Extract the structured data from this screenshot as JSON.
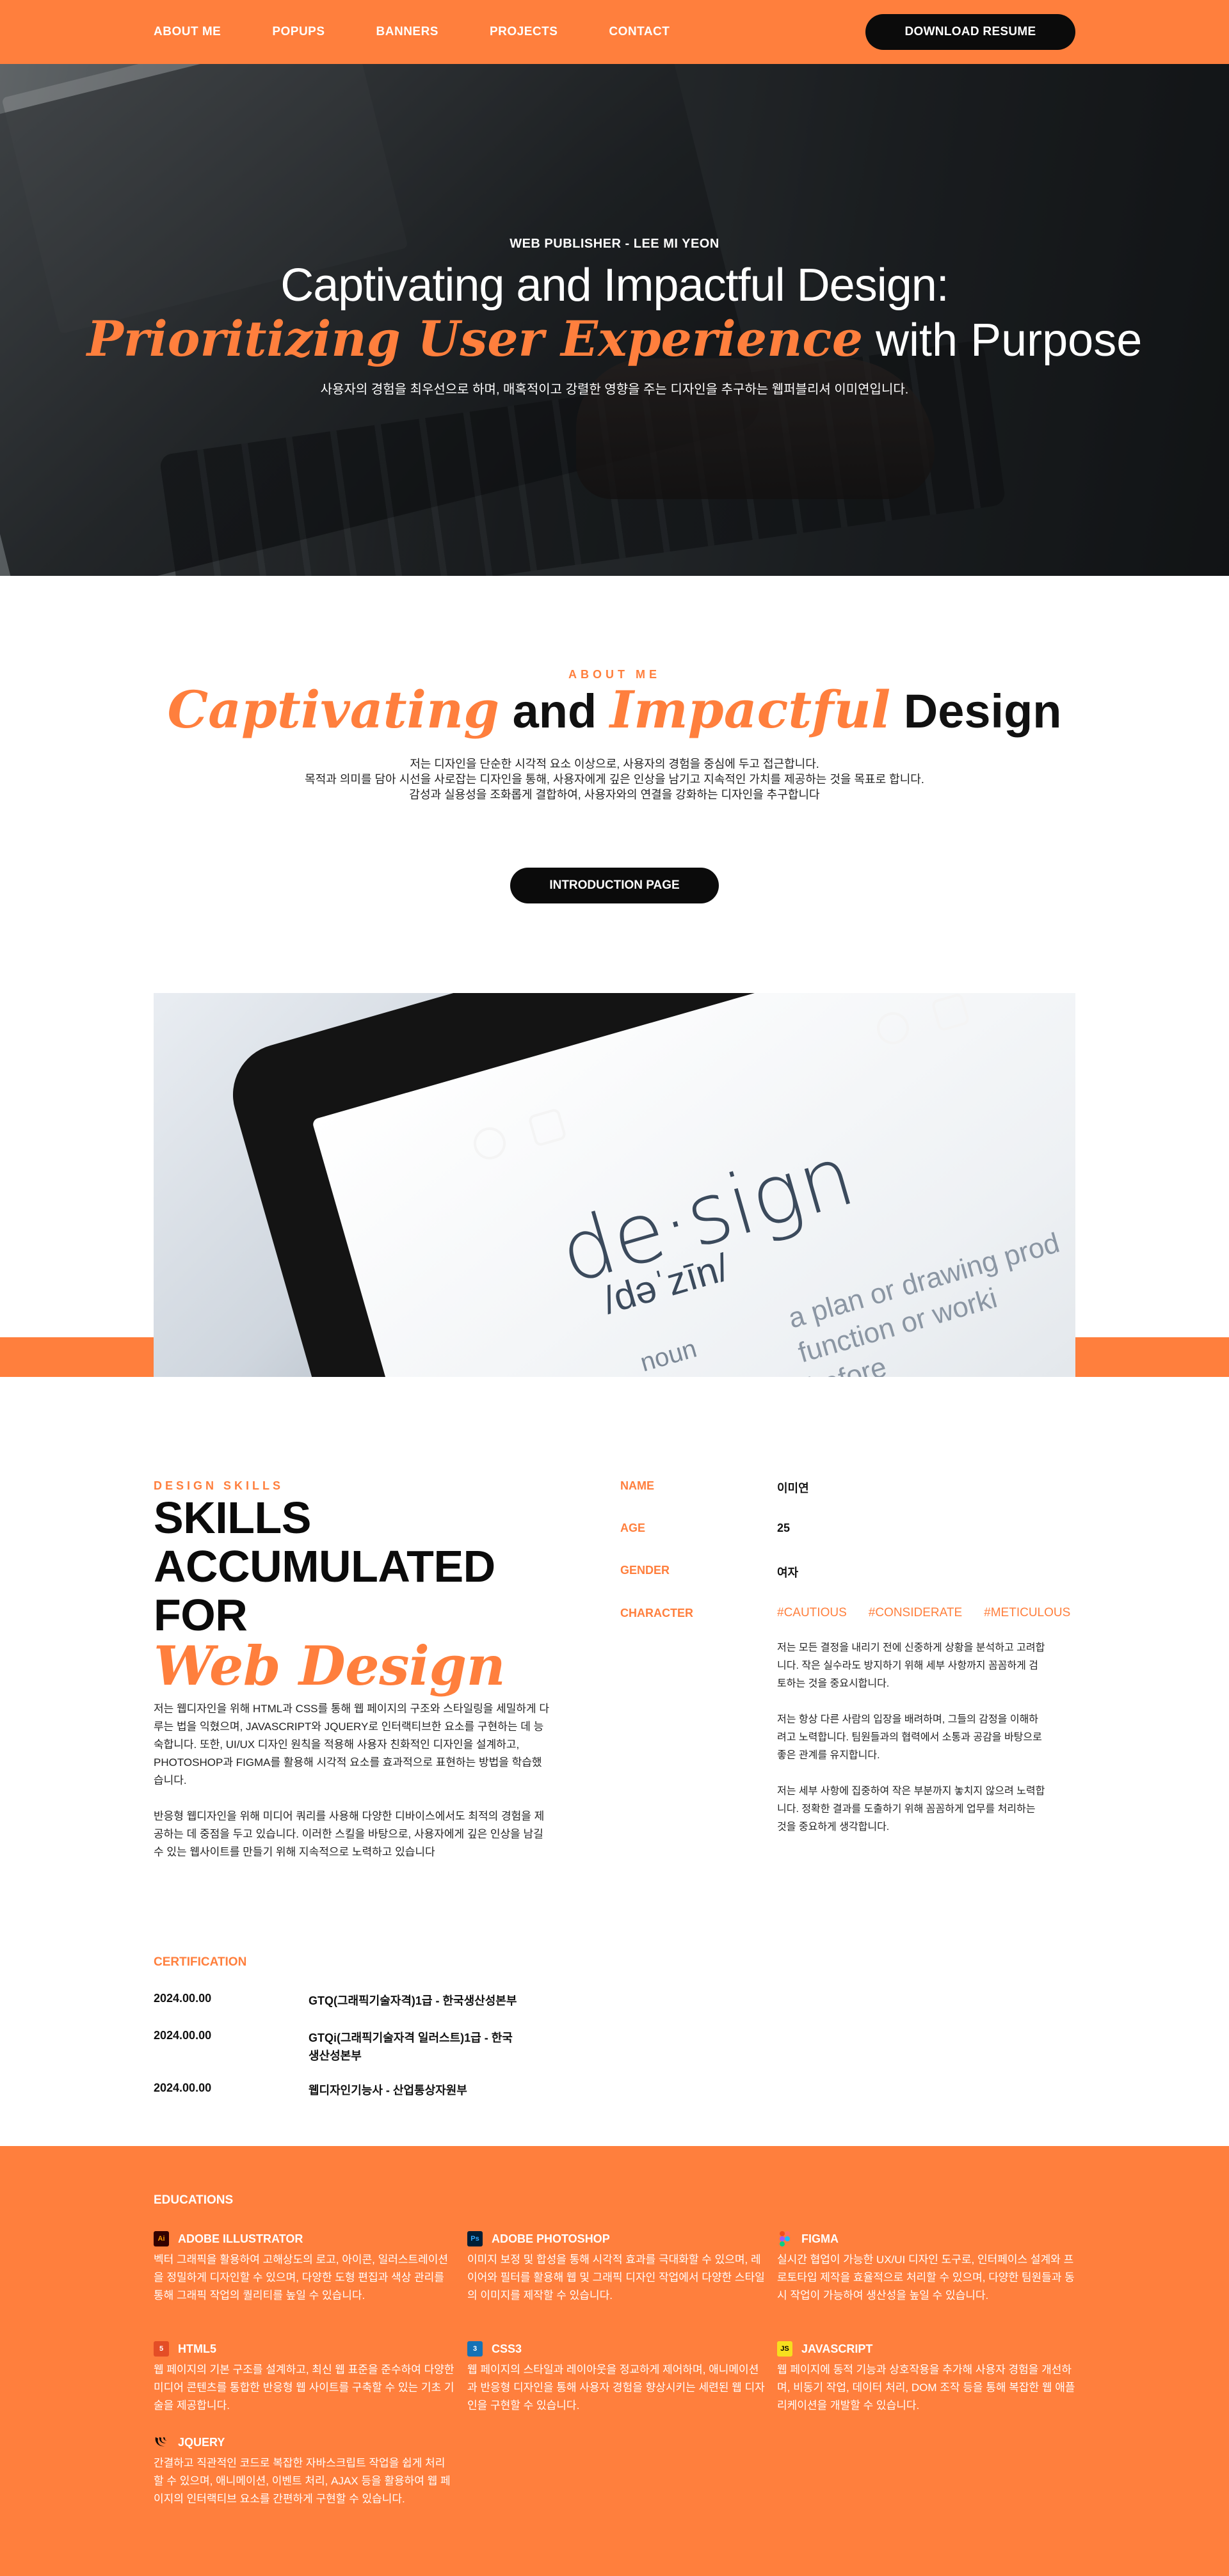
{
  "nav": {
    "links": [
      "ABOUT ME",
      "POPUPS",
      "BANNERS",
      "PROJECTS",
      "CONTACT"
    ],
    "download_label": "DOWNLOAD RESUME"
  },
  "hero": {
    "kicker": "WEB PUBLISHER - LEE MI YEON",
    "line1": "Captivating and Impactful Design:",
    "line2_accent": "Prioritizing User Experience",
    "line2_rest": " with Purpose",
    "sub": "사용자의 경험을 최우선으로 하며, 매혹적이고 강렬한 영향을 주는 디자인을 추구하는 웹퍼블리셔 이미연입니다."
  },
  "about": {
    "kicker": "ABOUT ME",
    "title_accent1": "Captivating",
    "title_and": " and ",
    "title_accent2": "Impactful",
    "title_design": " Design",
    "desc": [
      "저는 디자인을 단순한 시각적 요소 이상으로, 사용자의 경험을 중심에 두고 접근합니다.",
      "목적과 의미를 담아 시선을 사로잡는 디자인을 통해, 사용자에게 깊은 인상을 남기고 지속적인 가치를 제공하는 것을 목표로 합니다.",
      "감성과 실용성을 조화롭게 결합하여, 사용자와의 연결을 강화하는 디자인을 추구합니다"
    ],
    "button_label": "INTRODUCTION PAGE"
  },
  "design_image": {
    "word": "de·sign",
    "phonetic": "/dəˈzīn/",
    "pos": "noun",
    "definition": [
      "a plan or drawing prod",
      "function or worki",
      "before"
    ]
  },
  "skills": {
    "kicker": "DESIGN SKILLS",
    "title_lines": [
      "SKILLS",
      "ACCUMULATED",
      "FOR"
    ],
    "title_accent": "Web Design",
    "desc": [
      "저는 웹디자인을 위해 HTML과 CSS를 통해 웹 페이지의 구조와 스타일링을 세밀하게 다루는 법을 익혔으며, JAVASCRIPT와 JQUERY로 인터랙티브한 요소를 구현하는 데 능숙합니다. 또한, UI/UX 디자인 원칙을 적용해 사용자 친화적인 디자인을 설계하고, PHOTOSHOP과 FIGMA를 활용해 시각적 요소를 효과적으로 표현하는 방법을 학습했습니다.",
      "반응형 웹디자인을 위해 미디어 쿼리를 사용해 다양한 디바이스에서도 최적의 경험을 제공하는 데 중점을 두고 있습니다. 이러한 스킬을 바탕으로, 사용자에게 깊은 인상을 남길 수 있는 웹사이트를 만들기 위해 지속적으로 노력하고 있습니다"
    ]
  },
  "profile": {
    "name_label": "NAME",
    "name_value": "이미연",
    "age_label": "AGE",
    "age_value": "25",
    "gender_label": "GENDER",
    "gender_value": "여자",
    "character_label": "CHARACTER",
    "tags": [
      "#CAUTIOUS",
      "#CONSIDERATE",
      "#METICULOUS"
    ],
    "character_desc": [
      "저는 모든 결정을 내리기 전에 신중하게 상황을 분석하고 고려합니다. 작은 실수라도 방지하기 위해 세부 사항까지 꼼꼼하게 검토하는 것을 중요시합니다.",
      "저는 항상 다른 사람의 입장을 배려하며, 그들의 감정을 이해하려고 노력합니다. 팀원들과의 협력에서 소통과 공감을 바탕으로 좋은 관계를 유지합니다.",
      "저는 세부 사항에 집중하여 작은 부분까지 놓치지 않으려 노력합니다. 정확한 결과를 도출하기 위해 꼼꼼하게 업무를 처리하는 것을 중요하게 생각합니다."
    ]
  },
  "certification": {
    "title": "CERTIFICATION",
    "items": [
      {
        "date": "2024.00.00",
        "name": "GTQ(그래픽기술자격)1급 - 한국생산성본부"
      },
      {
        "date": "2024.00.00",
        "name": "GTQi(그래픽기술자격 일러스트)1급 - 한국생산성본부"
      },
      {
        "date": "2024.00.00",
        "name": "웹디자인기능사 - 산업통상자원부"
      }
    ]
  },
  "educations": {
    "title": "EDUCATIONS",
    "items": [
      {
        "name": "ADOBE ILLUSTRATOR",
        "icon": "illustrator-icon",
        "icon_text": "Ai",
        "color": "#ff9a00",
        "bg": "#330000",
        "desc": "벡터 그래픽을 활용하여 고해상도의 로고, 아이콘, 일러스트레이션을 정밀하게 디자인할 수 있으며, 다양한 도형 편집과 색상 관리를 통해 그래픽 작업의 퀄리티를 높일 수 있습니다."
      },
      {
        "name": "ADOBE PHOTOSHOP",
        "icon": "photoshop-icon",
        "icon_text": "Ps",
        "color": "#31a8ff",
        "bg": "#001e36",
        "desc": "이미지 보정 및 합성을 통해 시각적 효과를 극대화할 수 있으며, 레이어와 필터를 활용해 웹 및 그래픽 디자인 작업에서 다양한 스타일의 이미지를 제작할 수 있습니다."
      },
      {
        "name": "FIGMA",
        "icon": "figma-icon",
        "icon_text": "",
        "desc": "실시간 협업이 가능한 UX/UI 디자인 도구로, 인터페이스 설계와 프로토타입 제작을 효율적으로 처리할 수 있으며, 다양한 팀원들과 동시 작업이 가능하여 생산성을 높일 수 있습니다."
      },
      {
        "name": "HTML5",
        "icon": "html5-icon",
        "icon_text": "5",
        "color": "#ffffff",
        "bg": "#e44d26",
        "desc": "웹 페이지의 기본 구조를 설계하고, 최신 웹 표준을 준수하여 다양한 미디어 콘텐츠를 통합한 반응형 웹 사이트를 구축할 수 있는 기초 기술을 제공합니다."
      },
      {
        "name": "CSS3",
        "icon": "css3-icon",
        "icon_text": "3",
        "color": "#ffffff",
        "bg": "#1572b6",
        "desc": "웹 페이지의 스타일과 레이아웃을 정교하게 제어하며, 애니메이션과 반응형 디자인을 통해 사용자 경험을 향상시키는 세련된 웹 디자인을 구현할 수 있습니다."
      },
      {
        "name": "JAVASCRIPT",
        "icon": "javascript-icon",
        "icon_text": "JS",
        "color": "#000000",
        "bg": "#f7df1e",
        "desc": "웹 페이지에 동적 기능과 상호작용을 추가해 사용자 경험을 개선하며, 비동기 작업, 데이터 처리, DOM 조작 등을 통해 복잡한 웹 애플리케이션을 개발할 수 있습니다."
      },
      {
        "name": "JQUERY",
        "icon": "jquery-icon",
        "icon_text": "",
        "desc": "간결하고 직관적인 코드로 복잡한 자바스크립트 작업을 쉽게 처리할 수 있으며, 애니메이션, 이벤트 처리, AJAX 등을 활용하여 웹 페이지의 인터랙티브 요소를 간편하게 구현할 수 있습니다."
      }
    ]
  },
  "colors": {
    "accent": "#ff7f3d",
    "dark": "#0b0b0b"
  }
}
